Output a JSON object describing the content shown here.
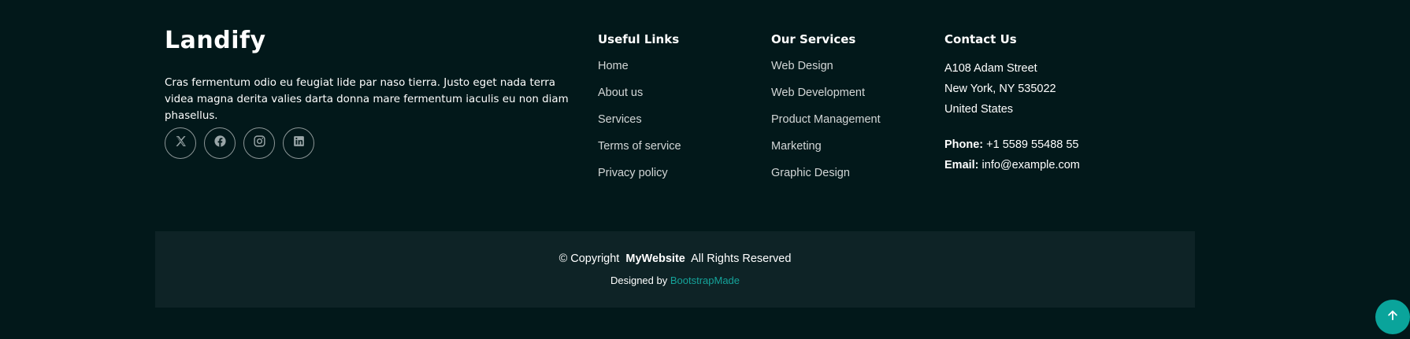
{
  "brand": {
    "name": "Landify",
    "description": "Cras fermentum odio eu feugiat lide par naso tierra. Justo eget nada terra videa magna derita valies darta donna mare fermentum iaculis eu non diam phasellus."
  },
  "social": [
    {
      "name": "x-twitter-icon"
    },
    {
      "name": "facebook-icon"
    },
    {
      "name": "instagram-icon"
    },
    {
      "name": "linkedin-icon"
    }
  ],
  "useful_links": {
    "heading": "Useful Links",
    "items": [
      "Home",
      "About us",
      "Services",
      "Terms of service",
      "Privacy policy"
    ]
  },
  "our_services": {
    "heading": "Our Services",
    "items": [
      "Web Design",
      "Web Development",
      "Product Management",
      "Marketing",
      "Graphic Design"
    ]
  },
  "contact": {
    "heading": "Contact Us",
    "street": "A108 Adam Street",
    "city": "New York, NY 535022",
    "country": "United States",
    "phone_label": "Phone:",
    "phone": "+1 5589 55488 55",
    "email_label": "Email:",
    "email": "info@example.com"
  },
  "footer": {
    "copyright_prefix": "© Copyright",
    "site_name": "MyWebsite",
    "rights": "All Rights Reserved",
    "designed_by": "Designed by",
    "designer": "BootstrapMade"
  },
  "scroll_top": {
    "icon": "arrow-up-icon"
  },
  "colors": {
    "background": "#02181a",
    "bottom_bar": "#0e2326",
    "accent": "#0aa49b",
    "link_accent": "#15a39a"
  }
}
